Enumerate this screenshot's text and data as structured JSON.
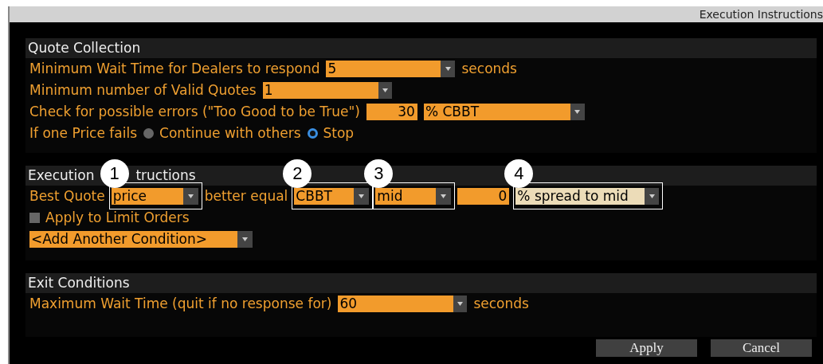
{
  "window": {
    "title": "Execution Instructions"
  },
  "sections": [
    {
      "title_parts": [
        "Quote Collection"
      ],
      "rows": [
        {
          "items": [
            {
              "kind": "label",
              "text": "Minimum Wait Time for Dealers to respond"
            },
            {
              "kind": "dropdown",
              "value": "5"
            },
            {
              "kind": "label",
              "text": "seconds"
            }
          ]
        },
        {
          "items": [
            {
              "kind": "label",
              "text": "Minimum number of Valid Quotes"
            },
            {
              "kind": "dropdown",
              "value": "1"
            }
          ]
        },
        {
          "items": [
            {
              "kind": "label",
              "text": "Check for possible errors (\"Too Good to be True\")"
            },
            {
              "kind": "input",
              "value": "30"
            },
            {
              "kind": "dropdown",
              "value": "% CBBT"
            }
          ]
        },
        {
          "items": [
            {
              "kind": "label",
              "text": "If one Price fails"
            },
            {
              "kind": "radio",
              "text": "Continue with others",
              "selected": false
            },
            {
              "kind": "radio",
              "text": "Stop",
              "selected": true
            }
          ]
        }
      ]
    },
    {
      "title_parts": [
        "Execution",
        "tructions"
      ],
      "rows": [
        {
          "items": [
            {
              "kind": "label",
              "text": "Best Quote"
            },
            {
              "kind": "dropdown",
              "value": "price",
              "callout": "1"
            },
            {
              "kind": "label",
              "text": "better equal"
            },
            {
              "kind": "dropdown",
              "value": "CBBT",
              "callout": "2"
            },
            {
              "kind": "dropdown",
              "value": "mid",
              "callout": "3"
            },
            {
              "kind": "input",
              "value": "0"
            },
            {
              "kind": "dropdown",
              "value": "% spread to mid",
              "callout": "4",
              "focused": true
            }
          ]
        },
        {
          "items": [
            {
              "kind": "checkbox",
              "text": "Apply to Limit Orders",
              "checked": false
            }
          ]
        },
        {
          "items": [
            {
              "kind": "dropdown",
              "value": "<Add Another Condition>"
            }
          ]
        }
      ]
    },
    {
      "title_parts": [
        "Exit Conditions"
      ],
      "rows": [
        {
          "items": [
            {
              "kind": "label",
              "text": "Maximum Wait Time (quit if no response for)"
            },
            {
              "kind": "dropdown",
              "value": "60"
            },
            {
              "kind": "label",
              "text": "seconds"
            }
          ]
        }
      ]
    }
  ],
  "buttons": [
    "Apply",
    "Cancel"
  ]
}
